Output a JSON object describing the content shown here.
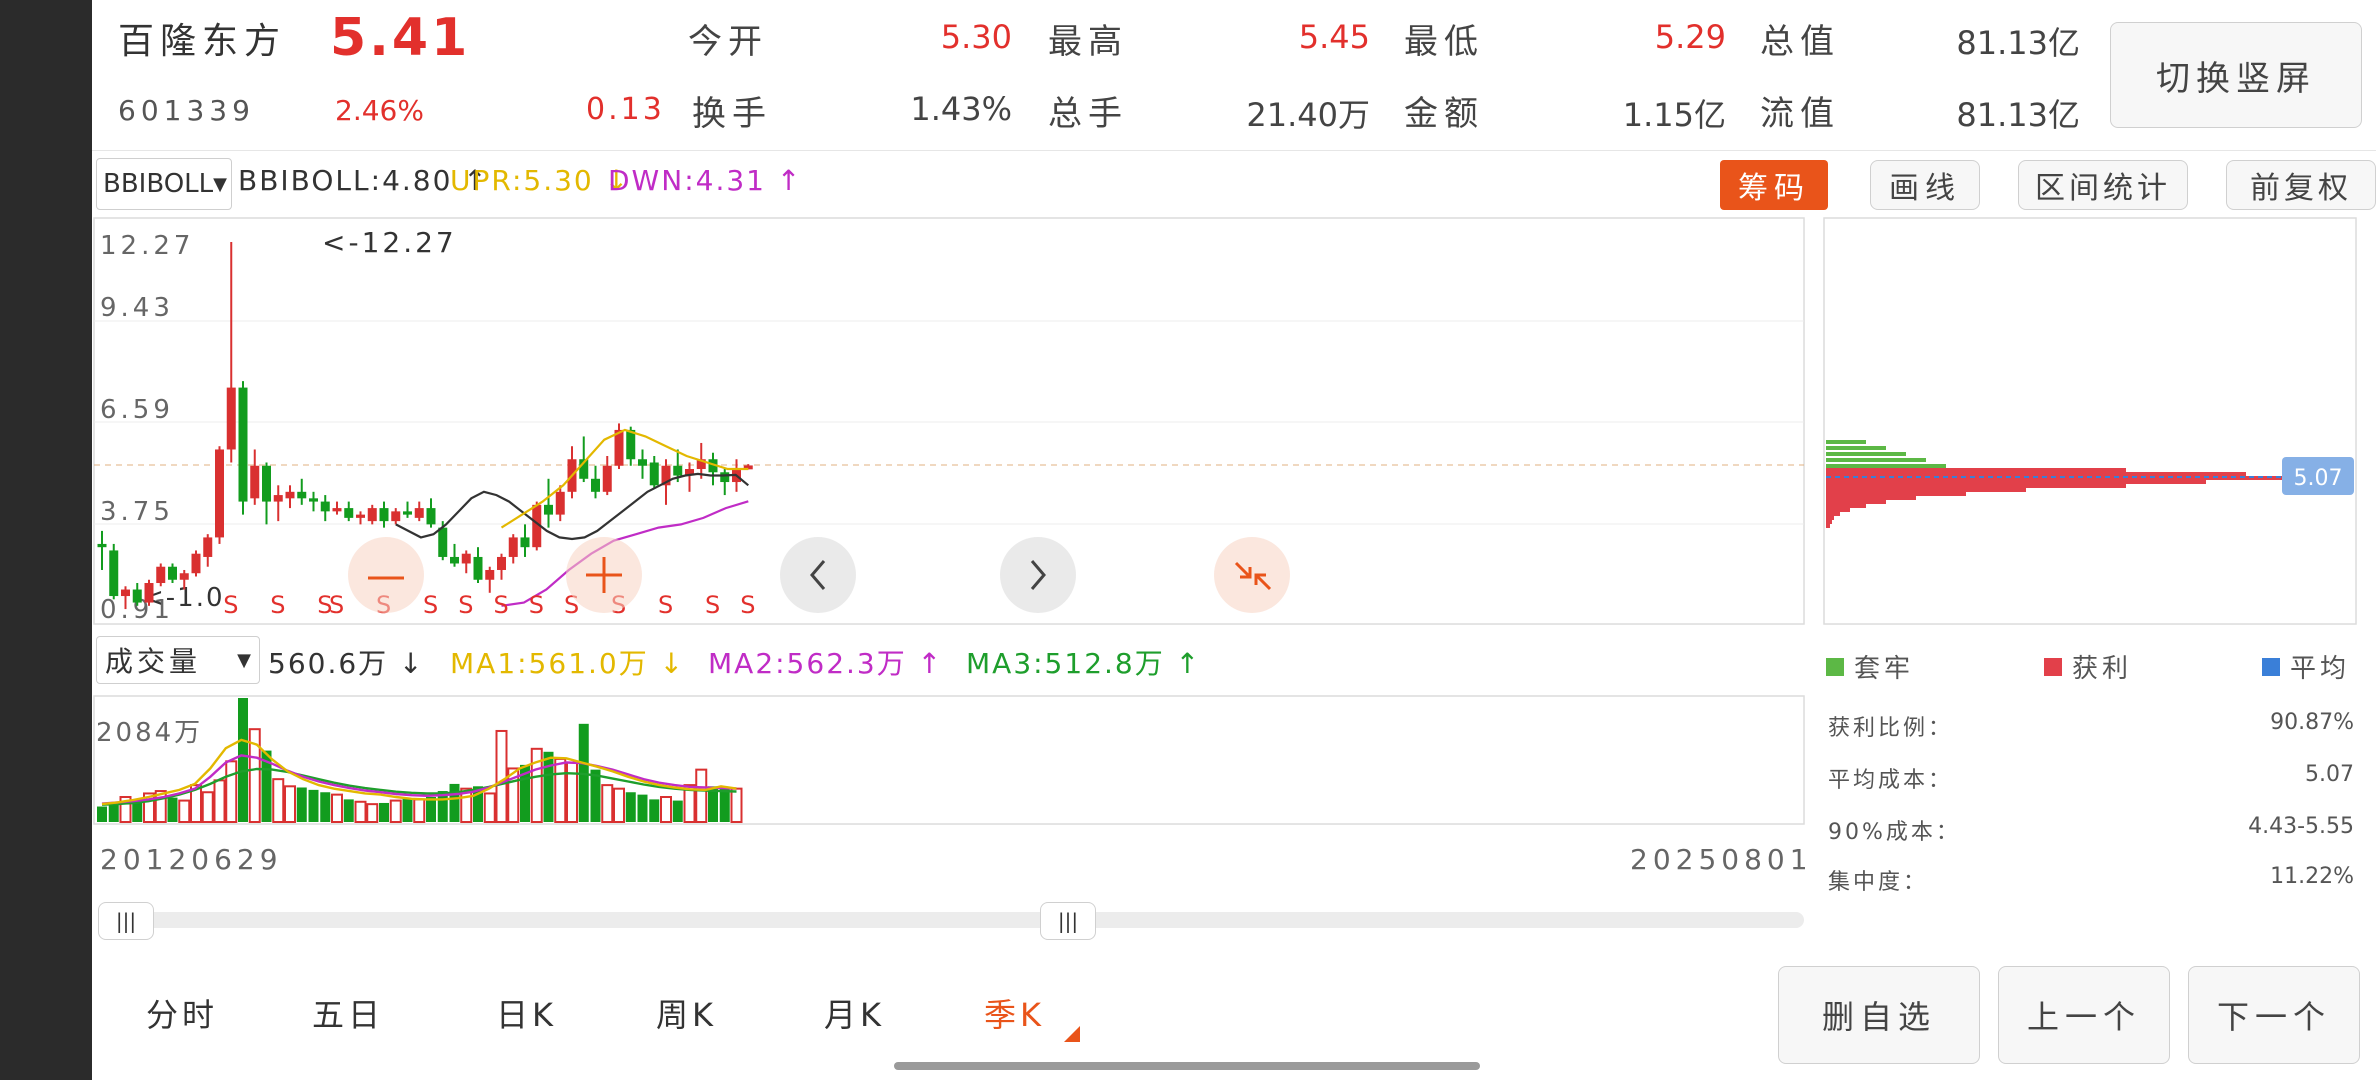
{
  "stock": {
    "name": "百隆东方",
    "code": "601339",
    "price": "5.41",
    "change_pct": "2.46%",
    "change": "0.13"
  },
  "quote": [
    {
      "label": "今开",
      "value": "5.30",
      "color": "#e2302c"
    },
    {
      "label": "最高",
      "value": "5.45",
      "color": "#e2302c"
    },
    {
      "label": "最低",
      "value": "5.29",
      "color": "#e2302c"
    },
    {
      "label": "总值",
      "value": "81.13亿",
      "color": "#444444"
    },
    {
      "label": "换手",
      "value": "1.43%",
      "color": "#444444"
    },
    {
      "label": "总手",
      "value": "21.40万",
      "color": "#444444"
    },
    {
      "label": "金额",
      "value": "1.15亿",
      "color": "#444444"
    },
    {
      "label": "流值",
      "value": "81.13亿",
      "color": "#444444"
    }
  ],
  "switch_button": "切换竖屏",
  "indicator": {
    "selector": "BBIBOLL",
    "bbi": "BBIBOLL:4.80 ↑",
    "upr": "UPR:5.30 ↓",
    "dwn": "DWN:4.31 ↑",
    "colors": {
      "bbi": "#333333",
      "upr": "#e3b800",
      "dwn": "#c02cc6"
    }
  },
  "toolbar": {
    "chips": "筹码",
    "draw": "画线",
    "range": "区间统计",
    "adjust": "前复权"
  },
  "price_axis": [
    "12.27",
    "9.43",
    "6.59",
    "3.75",
    "0.91"
  ],
  "max_marker": "<-12.27",
  "low_marker": "<-1.0",
  "signal_letter": "S",
  "volume": {
    "selector": "成交量",
    "vol": "560.6万 ↓",
    "ma1": "MA1:561.0万 ↓",
    "ma2": "MA2:562.3万 ↑",
    "ma3": "MA3:512.8万 ↑",
    "axis_top": "2084万",
    "colors": {
      "ma1": "#e3b800",
      "ma2": "#c02cc6",
      "ma3": "#1e9e2c"
    }
  },
  "dates": {
    "start": "20120629",
    "end": "20250801"
  },
  "chip": {
    "avg_badge": "5.07",
    "legend": [
      {
        "label": "套牢",
        "color": "#5cb845"
      },
      {
        "label": "获利",
        "color": "#e2404a"
      },
      {
        "label": "平均",
        "color": "#3a7fd8"
      }
    ],
    "stats": [
      {
        "label": "获利比例：",
        "value": "90.87%"
      },
      {
        "label": "平均成本：",
        "value": "5.07"
      },
      {
        "label": "90%成本：",
        "value": "4.43-5.55"
      },
      {
        "label": "集中度：",
        "value": "11.22%"
      }
    ]
  },
  "period_tabs": [
    {
      "label": "分时",
      "active": false
    },
    {
      "label": "五日",
      "active": false
    },
    {
      "label": "日K",
      "active": false
    },
    {
      "label": "周K",
      "active": false
    },
    {
      "label": "月K",
      "active": false
    },
    {
      "label": "季K",
      "active": true
    }
  ],
  "actions": {
    "delete": "删自选",
    "prev": "上一个",
    "next": "下一个"
  },
  "chart_data": {
    "type": "candlestick",
    "period": "quarterly",
    "price_axis_ticks": [
      12.27,
      9.43,
      6.59,
      3.75,
      0.91
    ],
    "price_range": [
      0.91,
      12.27
    ],
    "max_price_label": 12.27,
    "candles": [
      {
        "o": 3.0,
        "h": 3.4,
        "l": 2.2,
        "c": 2.9
      },
      {
        "o": 2.8,
        "h": 3.0,
        "l": 1.3,
        "c": 1.4
      },
      {
        "o": 1.4,
        "h": 1.7,
        "l": 1.0,
        "c": 1.6
      },
      {
        "o": 1.6,
        "h": 1.8,
        "l": 1.1,
        "c": 1.2
      },
      {
        "o": 1.2,
        "h": 1.9,
        "l": 1.1,
        "c": 1.8
      },
      {
        "o": 1.8,
        "h": 2.4,
        "l": 1.7,
        "c": 2.3
      },
      {
        "o": 2.3,
        "h": 2.4,
        "l": 1.8,
        "c": 1.9
      },
      {
        "o": 1.9,
        "h": 2.2,
        "l": 1.6,
        "c": 2.1
      },
      {
        "o": 2.1,
        "h": 2.8,
        "l": 2.0,
        "c": 2.7
      },
      {
        "o": 2.6,
        "h": 3.3,
        "l": 2.3,
        "c": 3.2
      },
      {
        "o": 3.2,
        "h": 6.0,
        "l": 3.0,
        "c": 5.9
      },
      {
        "o": 5.9,
        "h": 12.27,
        "l": 5.5,
        "c": 7.8
      },
      {
        "o": 7.8,
        "h": 8.0,
        "l": 3.9,
        "c": 4.3
      },
      {
        "o": 4.4,
        "h": 5.9,
        "l": 4.2,
        "c": 5.4
      },
      {
        "o": 5.4,
        "h": 5.5,
        "l": 3.6,
        "c": 4.3
      },
      {
        "o": 4.3,
        "h": 4.8,
        "l": 3.7,
        "c": 4.5
      },
      {
        "o": 4.4,
        "h": 4.8,
        "l": 4.1,
        "c": 4.6
      },
      {
        "o": 4.6,
        "h": 5.0,
        "l": 4.2,
        "c": 4.4
      },
      {
        "o": 4.4,
        "h": 4.6,
        "l": 4.0,
        "c": 4.3
      },
      {
        "o": 4.3,
        "h": 4.5,
        "l": 3.7,
        "c": 4.0
      },
      {
        "o": 4.0,
        "h": 4.3,
        "l": 3.9,
        "c": 4.1
      },
      {
        "o": 4.1,
        "h": 4.3,
        "l": 3.7,
        "c": 3.8
      },
      {
        "o": 3.8,
        "h": 4.0,
        "l": 3.6,
        "c": 3.9
      },
      {
        "o": 3.7,
        "h": 4.2,
        "l": 3.6,
        "c": 4.1
      },
      {
        "o": 4.1,
        "h": 4.3,
        "l": 3.5,
        "c": 3.7
      },
      {
        "o": 3.7,
        "h": 4.1,
        "l": 3.6,
        "c": 4.0
      },
      {
        "o": 4.0,
        "h": 4.3,
        "l": 3.8,
        "c": 3.9
      },
      {
        "o": 3.8,
        "h": 4.3,
        "l": 3.7,
        "c": 4.1
      },
      {
        "o": 4.1,
        "h": 4.4,
        "l": 3.5,
        "c": 3.6
      },
      {
        "o": 3.5,
        "h": 3.7,
        "l": 2.5,
        "c": 2.6
      },
      {
        "o": 2.6,
        "h": 3.0,
        "l": 2.3,
        "c": 2.4
      },
      {
        "o": 2.4,
        "h": 2.8,
        "l": 2.1,
        "c": 2.7
      },
      {
        "o": 2.6,
        "h": 2.9,
        "l": 1.8,
        "c": 1.9
      },
      {
        "o": 1.9,
        "h": 2.3,
        "l": 1.5,
        "c": 2.2
      },
      {
        "o": 2.2,
        "h": 2.7,
        "l": 1.9,
        "c": 2.6
      },
      {
        "o": 2.6,
        "h": 3.3,
        "l": 2.4,
        "c": 3.2
      },
      {
        "o": 3.2,
        "h": 3.6,
        "l": 2.6,
        "c": 2.9
      },
      {
        "o": 2.9,
        "h": 4.3,
        "l": 2.8,
        "c": 4.2
      },
      {
        "o": 4.2,
        "h": 5.0,
        "l": 3.5,
        "c": 3.9
      },
      {
        "o": 3.9,
        "h": 4.8,
        "l": 3.7,
        "c": 4.6
      },
      {
        "o": 4.6,
        "h": 6.0,
        "l": 4.4,
        "c": 5.6
      },
      {
        "o": 5.6,
        "h": 6.3,
        "l": 4.9,
        "c": 5.0
      },
      {
        "o": 5.0,
        "h": 5.4,
        "l": 4.4,
        "c": 4.6
      },
      {
        "o": 4.6,
        "h": 5.7,
        "l": 4.5,
        "c": 5.4
      },
      {
        "o": 5.4,
        "h": 6.7,
        "l": 5.3,
        "c": 6.5
      },
      {
        "o": 6.5,
        "h": 6.6,
        "l": 5.4,
        "c": 5.6
      },
      {
        "o": 5.6,
        "h": 5.9,
        "l": 5.0,
        "c": 5.4
      },
      {
        "o": 5.5,
        "h": 5.7,
        "l": 4.7,
        "c": 4.8
      },
      {
        "o": 4.8,
        "h": 5.6,
        "l": 4.2,
        "c": 5.4
      },
      {
        "o": 5.4,
        "h": 5.9,
        "l": 4.9,
        "c": 5.1
      },
      {
        "o": 5.1,
        "h": 5.5,
        "l": 4.6,
        "c": 5.3
      },
      {
        "o": 5.3,
        "h": 6.1,
        "l": 5.0,
        "c": 5.6
      },
      {
        "o": 5.6,
        "h": 5.8,
        "l": 4.8,
        "c": 5.2
      },
      {
        "o": 5.2,
        "h": 5.3,
        "l": 4.5,
        "c": 4.9
      },
      {
        "o": 4.9,
        "h": 5.6,
        "l": 4.6,
        "c": 5.3
      },
      {
        "o": 5.29,
        "h": 5.45,
        "l": 5.29,
        "c": 5.41
      }
    ],
    "bbi_line": [
      3.6,
      3.4,
      3.2,
      3.3,
      3.6,
      4.0,
      4.4,
      4.6,
      4.5,
      4.3,
      4.0,
      3.7,
      3.4,
      3.2,
      3.15,
      3.2,
      3.4,
      3.7,
      4.0,
      4.3,
      4.6,
      4.8,
      5.0,
      5.1,
      5.15,
      5.1,
      5.1,
      5.12,
      4.8
    ],
    "upr_line": [
      3.5,
      3.9,
      4.3,
      4.8,
      5.5,
      6.2,
      6.5,
      6.3,
      6.0,
      5.7,
      5.5,
      5.3,
      5.3
    ],
    "dwn_line": [
      1.1,
      1.2,
      1.6,
      2.2,
      2.7,
      3.1,
      3.3,
      3.5,
      3.6,
      3.8,
      4.1,
      4.31
    ],
    "signal_count": 14,
    "volume_axis_top": "2084万",
    "volumes": [
      260,
      300,
      420,
      380,
      480,
      520,
      410,
      360,
      620,
      500,
      700,
      1020,
      2084,
      1560,
      1200,
      720,
      600,
      580,
      540,
      500,
      460,
      380,
      340,
      300,
      320,
      360,
      400,
      380,
      420,
      520,
      640,
      560,
      600,
      480,
      1530,
      900,
      960,
      1230,
      1180,
      1060,
      1000,
      1650,
      880,
      620,
      560,
      500,
      460,
      380,
      420,
      360,
      620,
      880,
      600,
      560,
      560.6
    ],
    "volume_ma1": [
      300,
      330,
      370,
      420,
      480,
      540,
      640,
      900,
      1240,
      1380,
      1300,
      1050,
      850,
      720,
      620,
      560,
      520,
      480,
      460,
      420,
      390,
      380,
      380,
      400,
      440,
      560,
      720,
      900,
      1000,
      1080,
      1070,
      1000,
      930,
      850,
      760,
      680,
      620,
      580,
      550,
      540,
      600,
      561
    ],
    "volume_ma2": [
      310,
      330,
      350,
      380,
      420,
      480,
      560,
      760,
      1000,
      1120,
      1080,
      980,
      860,
      760,
      680,
      620,
      570,
      530,
      500,
      470,
      450,
      440,
      450,
      470,
      510,
      580,
      680,
      780,
      880,
      950,
      1000,
      990,
      940,
      880,
      800,
      720,
      660,
      620,
      590,
      580,
      570,
      562.3
    ],
    "volume_ma3": [
      290,
      300,
      320,
      350,
      400,
      460,
      540,
      640,
      760,
      850,
      890,
      880,
      840,
      780,
      720,
      660,
      610,
      570,
      540,
      510,
      490,
      480,
      480,
      500,
      540,
      590,
      650,
      710,
      760,
      800,
      820,
      810,
      780,
      730,
      680,
      630,
      590,
      560,
      540,
      530,
      520,
      512.8
    ]
  }
}
